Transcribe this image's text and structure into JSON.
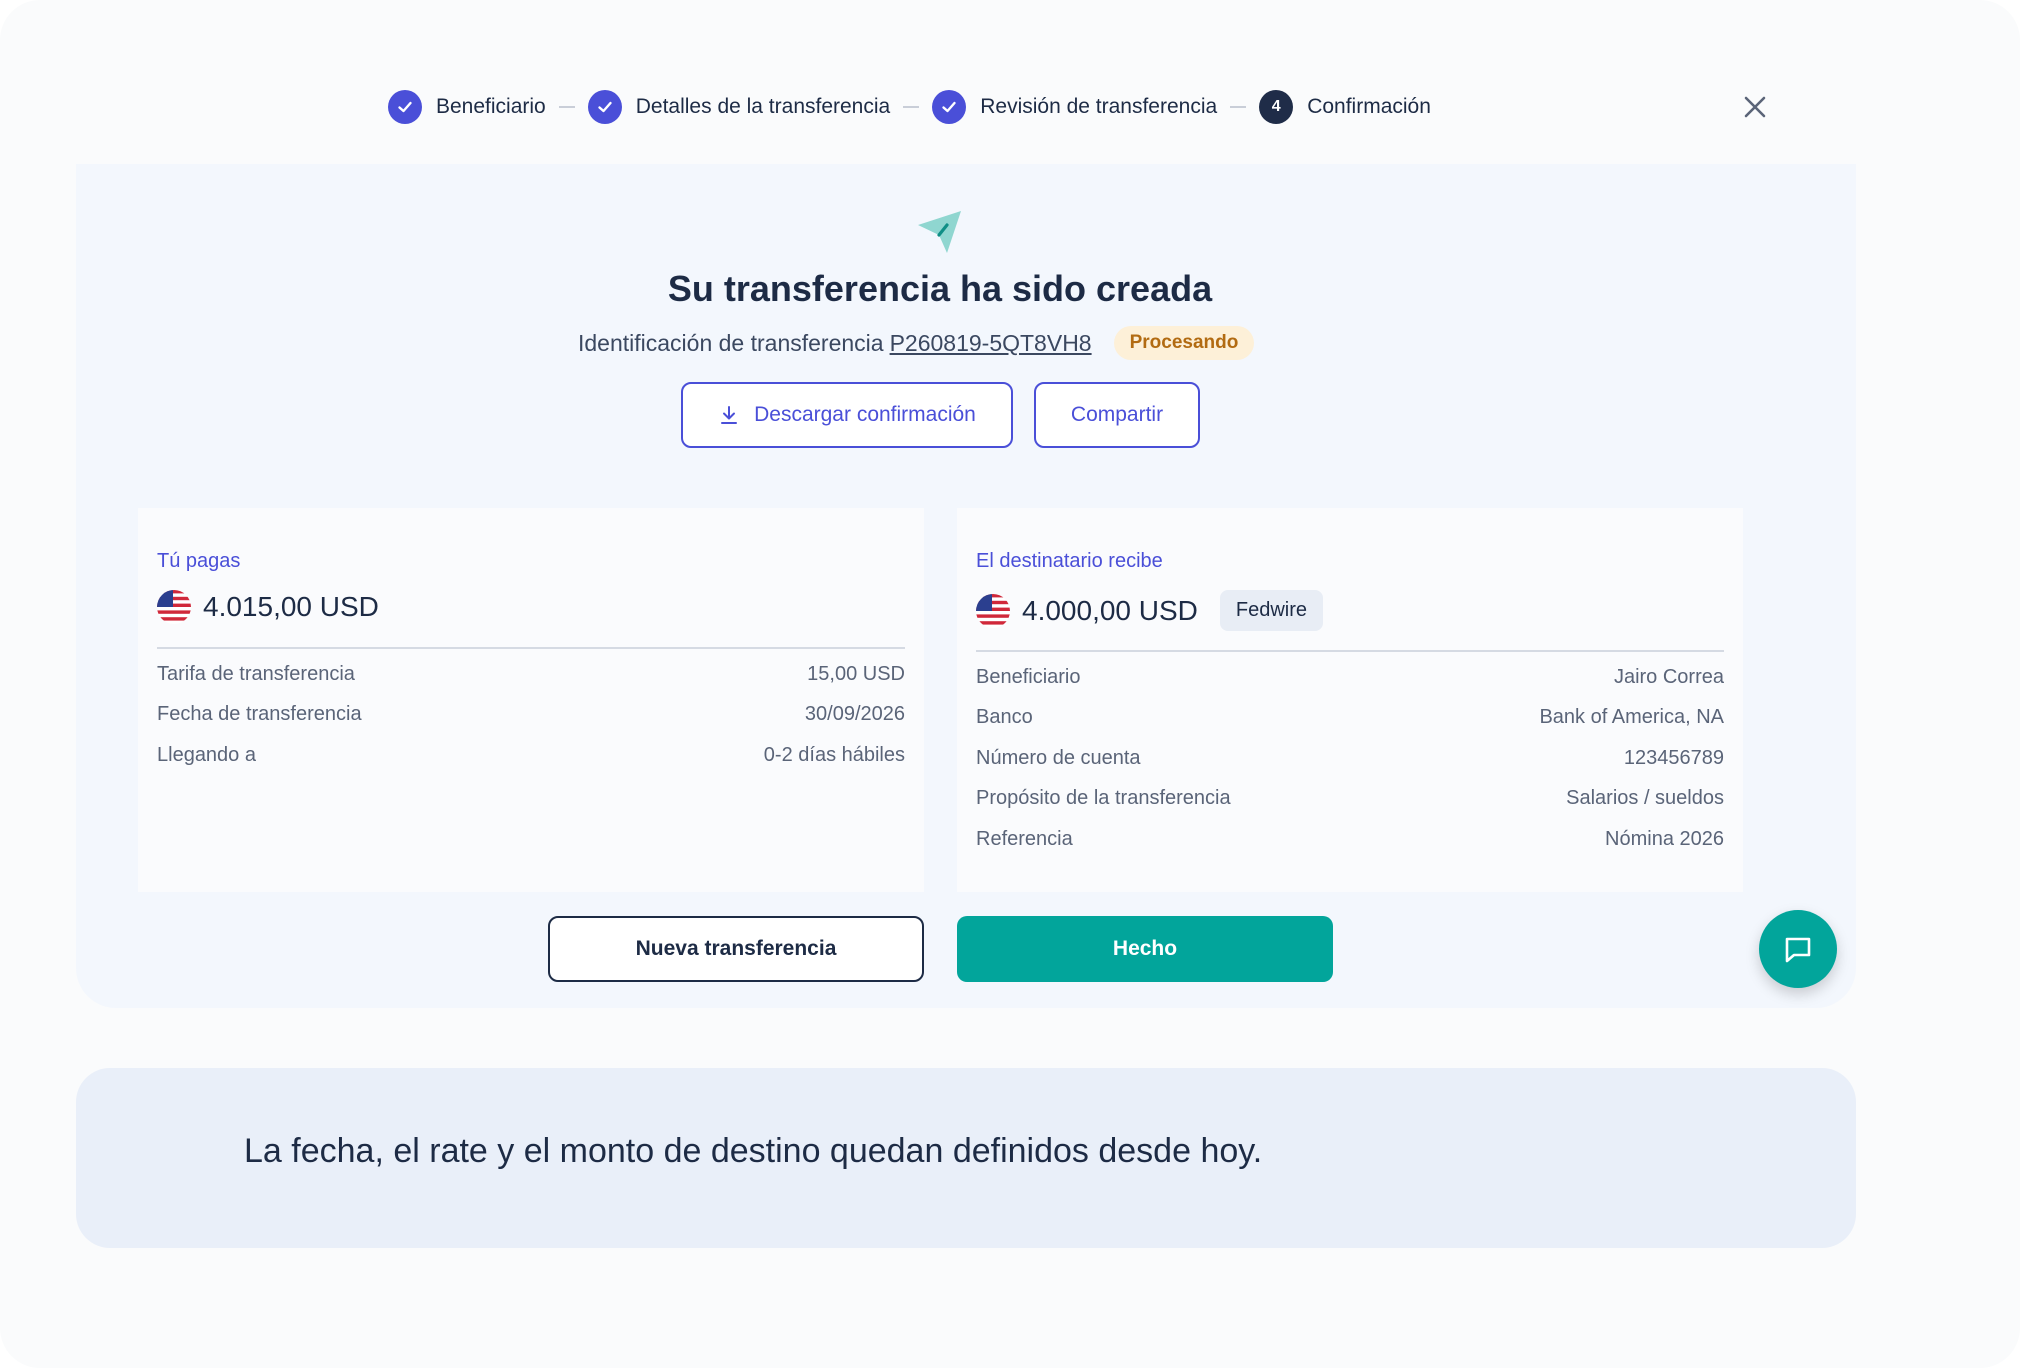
{
  "stepper": {
    "steps": [
      {
        "label": "Beneficiario",
        "state": "done"
      },
      {
        "label": "Detalles de la transferencia",
        "state": "done"
      },
      {
        "label": "Revisión de transferencia",
        "state": "done"
      },
      {
        "label": "Confirmación",
        "state": "current",
        "number": "4"
      }
    ]
  },
  "header": {
    "close_icon": "close-icon"
  },
  "confirmation": {
    "icon": "paper-plane-icon",
    "title": "Su transferencia ha sido creada",
    "id_label": "Identificación de transferencia",
    "id_value": "P260819-5QT8VH8",
    "status": "Procesando",
    "download_label": "Descargar confirmación",
    "share_label": "Compartir"
  },
  "you_pay": {
    "title": "Tú pagas",
    "amount": "4.015,00 USD",
    "rows": [
      {
        "label": "Tarifa de transferencia",
        "value": "15,00 USD"
      },
      {
        "label": "Fecha de transferencia",
        "value": "30/09/2026"
      },
      {
        "label": "Llegando a",
        "value": "0-2 días hábiles"
      }
    ]
  },
  "recipient_gets": {
    "title": "El destinatario recibe",
    "amount": "4.000,00 USD",
    "rail": "Fedwire",
    "rows": [
      {
        "label": "Beneficiario",
        "value": "Jairo Correa"
      },
      {
        "label": "Banco",
        "value": "Bank of America, NA"
      },
      {
        "label": "Número de cuenta",
        "value": "123456789"
      },
      {
        "label": "Propósito de la transferencia",
        "value": "Salarios / sueldos"
      },
      {
        "label": "Referencia",
        "value": "Nómina 2026"
      }
    ]
  },
  "actions": {
    "new_transfer": "Nueva transferencia",
    "done": "Hecho"
  },
  "note": {
    "text": "La fecha, el rate y el monto de destino quedan definidos desde hoy."
  },
  "colors": {
    "accent": "#4a4fd8",
    "primary_button": "#02a59b",
    "status_bg": "#fdf0d8",
    "status_text": "#b26b12"
  }
}
